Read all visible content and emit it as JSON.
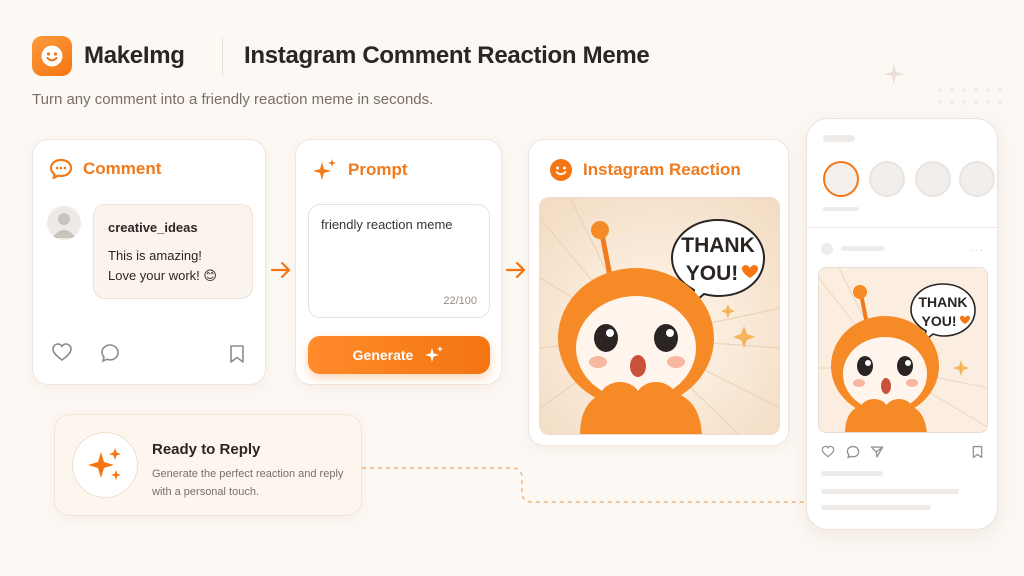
{
  "header": {
    "brand": "MakeImg",
    "title": "Instagram Comment Reaction Meme",
    "subtitle": "Turn any comment into a friendly reaction meme in seconds."
  },
  "comment_card": {
    "heading": "Comment",
    "username": "creative_ideas",
    "text_line1": "This is amazing!",
    "text_line2": "Love your work! 😊"
  },
  "prompt_card": {
    "heading": "Prompt",
    "value": "friendly reaction meme",
    "counter": "22/100",
    "generate_label": "Generate"
  },
  "reaction_card": {
    "heading": "Instagram Reaction",
    "meme_text_line1": "THANK",
    "meme_text_line2": "YOU!"
  },
  "ready_card": {
    "title": "Ready to Reply",
    "desc_line1": "Generate the perfect reaction and reply",
    "desc_line2": "with a personal touch."
  },
  "phone": {
    "meme_text_line1": "THANK",
    "meme_text_line2": "YOU!"
  },
  "colors": {
    "accent": "#f47512",
    "background": "#fcf8f4"
  },
  "icons": [
    "smile-logo-icon",
    "chat-bubble-icon",
    "sparkle-icon",
    "smile-icon",
    "heart-icon",
    "comment-icon",
    "bookmark-icon",
    "arrow-right-icon",
    "send-icon"
  ]
}
